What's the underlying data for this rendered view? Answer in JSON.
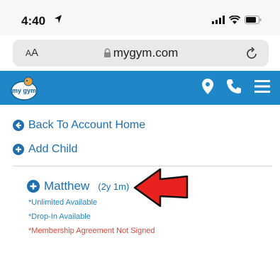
{
  "status_bar": {
    "time": "4:40"
  },
  "browser": {
    "aa_label": "A",
    "aa_big": "A",
    "url": "mygym.com"
  },
  "navbar": {
    "brand": "my gym"
  },
  "links": {
    "back": "Back To Account Home",
    "add_child": "Add Child"
  },
  "child": {
    "name": "Matthew",
    "age": "(2y 1m)",
    "notes": [
      "*Unlimited Available",
      "*Drop-In Available",
      "*Membership Agreement Not Signed"
    ]
  },
  "colors": {
    "brand_blue": "#1f86c8",
    "link_blue": "#1f6fae",
    "warning_red": "#e0443a",
    "arrow_red": "#e8231f"
  }
}
